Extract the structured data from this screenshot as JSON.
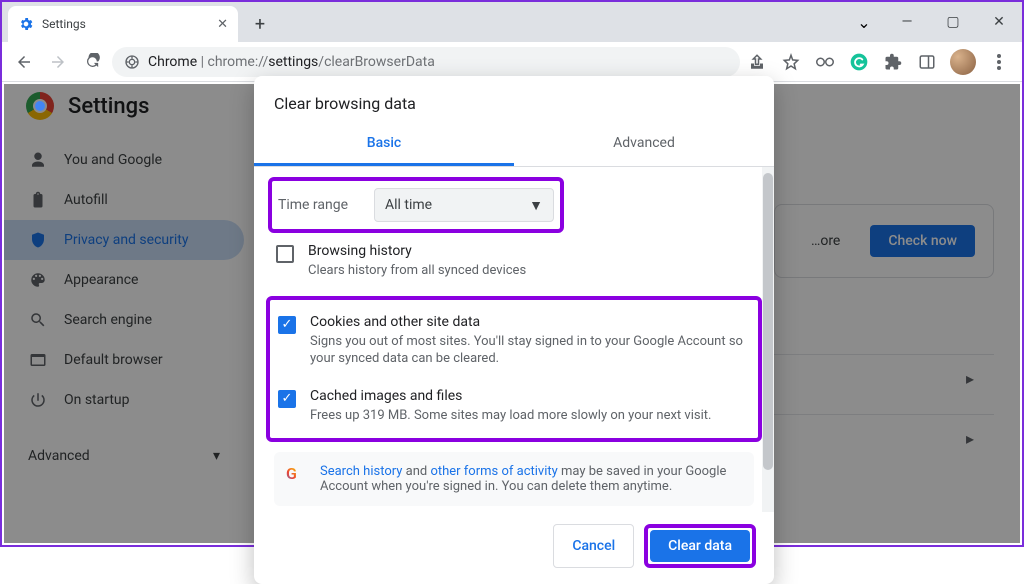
{
  "window": {
    "tab_title": "Settings",
    "caret": "⌄",
    "ctrls": {
      "min": "—",
      "max": "▢",
      "close": "✕"
    }
  },
  "toolbar": {
    "chrome_label": "Chrome",
    "url_prefix": "chrome://",
    "url_mid": "settings",
    "url_suffix": "/clearBrowserData"
  },
  "settings": {
    "title": "Settings",
    "nav": [
      {
        "icon": "person",
        "label": "You and Google"
      },
      {
        "icon": "clipboard",
        "label": "Autofill"
      },
      {
        "icon": "shield",
        "label": "Privacy and security"
      },
      {
        "icon": "palette",
        "label": "Appearance"
      },
      {
        "icon": "search",
        "label": "Search engine"
      },
      {
        "icon": "browser",
        "label": "Default browser"
      },
      {
        "icon": "power",
        "label": "On startup"
      }
    ],
    "advanced": "Advanced",
    "right_card_text": "…ore",
    "right_card_btn": "Check now"
  },
  "dialog": {
    "title": "Clear browsing data",
    "tabs": {
      "basic": "Basic",
      "advanced": "Advanced"
    },
    "time_range_label": "Time range",
    "time_range_value": "All time",
    "options": [
      {
        "checked": false,
        "title": "Browsing history",
        "desc": "Clears history from all synced devices"
      },
      {
        "checked": true,
        "title": "Cookies and other site data",
        "desc": "Signs you out of most sites. You'll stay signed in to your Google Account so your synced data can be cleared."
      },
      {
        "checked": true,
        "title": "Cached images and files",
        "desc": "Frees up 319 MB. Some sites may load more slowly on your next visit."
      }
    ],
    "info_link1": "Search history",
    "info_mid": " and ",
    "info_link2": "other forms of activity",
    "info_rest": " may be saved in your Google Account when you're signed in. You can delete them anytime.",
    "cancel": "Cancel",
    "clear": "Clear data"
  }
}
